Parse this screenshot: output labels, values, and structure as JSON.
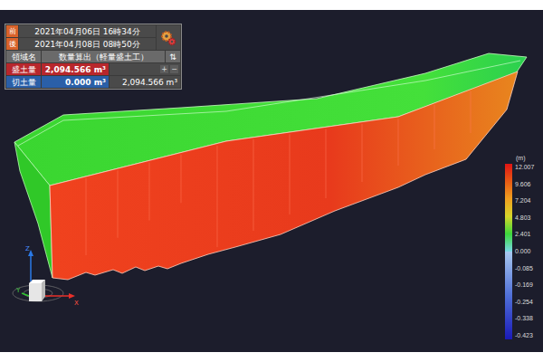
{
  "panel": {
    "dates": [
      {
        "badge": "前",
        "text": "2021年04月06日 16時34分"
      },
      {
        "badge": "後",
        "text": "2021年04月08日 08時50分"
      }
    ],
    "header": {
      "label": "領域名",
      "value": "数量算出（軽量盛土工）",
      "sort_icon": "⇅"
    },
    "volumes": [
      {
        "label": "盛土量",
        "value": "2,094.566 m³",
        "color": "#b8272c"
      },
      {
        "label": "切土量",
        "value": "0.000 m³",
        "color": "#2a5fa8"
      }
    ],
    "buttons": [
      "+",
      "−"
    ],
    "total": "2,094.566 m³"
  },
  "legend": {
    "unit": "(m)",
    "ticks": [
      "12.007",
      "9.606",
      "7.204",
      "4.803",
      "2.401",
      "0.000",
      "-0.085",
      "-0.169",
      "-0.254",
      "-0.338",
      "-0.423"
    ]
  },
  "axes": [
    "Z",
    "Y",
    "X"
  ]
}
